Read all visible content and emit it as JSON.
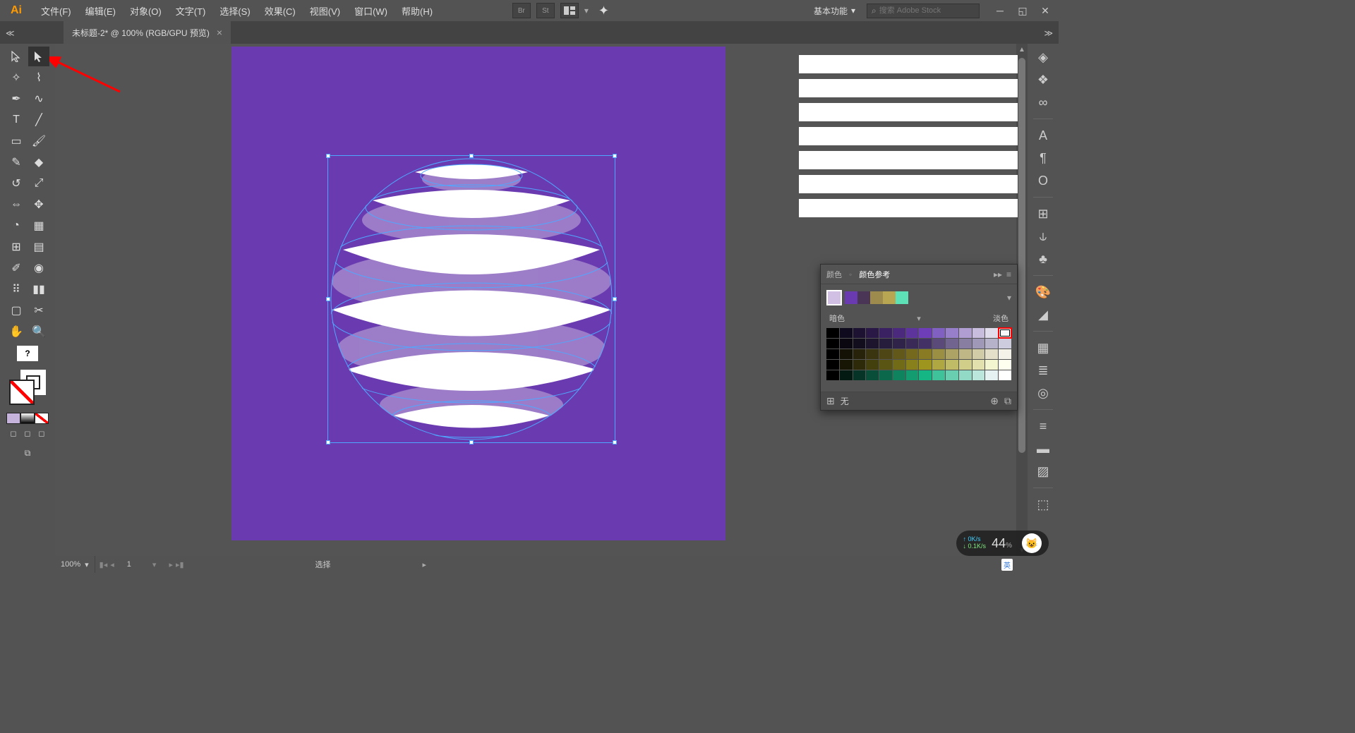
{
  "app": {
    "name": "Ai"
  },
  "menu": {
    "file": "文件(F)",
    "edit": "编辑(E)",
    "object": "对象(O)",
    "type": "文字(T)",
    "select": "选择(S)",
    "effect": "效果(C)",
    "view": "视图(V)",
    "window": "窗口(W)",
    "help": "帮助(H)"
  },
  "topbar": {
    "br": "Br",
    "st": "St",
    "workspace": "基本功能",
    "search_placeholder": "搜索 Adobe Stock"
  },
  "doc_tab": {
    "title": "未标题-2* @ 100% (RGB/GPU 预览)",
    "close": "×"
  },
  "zoom": {
    "value": "100%"
  },
  "artboard_nav": {
    "current": "1"
  },
  "status": {
    "tool": "选择"
  },
  "colorguide": {
    "tab1": "颜色",
    "tab2": "颜色参考",
    "dark_label": "暗色",
    "light_label": "淡色",
    "none_label": "无",
    "harmony_colors": [
      "#6a3bb0",
      "#4a3556",
      "#9d8a4d",
      "#b9a652",
      "#5de2b8"
    ],
    "main_swatch": "#d1bfe4",
    "grid": [
      [
        "#000000",
        "#100a1e",
        "#1e1232",
        "#2a1847",
        "#3a2162",
        "#4b2a7e",
        "#5c349b",
        "#6d3eb7",
        "#8060c0",
        "#987fc9",
        "#b09ed3",
        "#c8bddc",
        "#e0dceb",
        "#f8f8fb"
      ],
      [
        "#000000",
        "#0a0710",
        "#130e1e",
        "#1d152d",
        "#261c3b",
        "#302349",
        "#3a2a58",
        "#433166",
        "#5a4a7a",
        "#71648e",
        "#887ea2",
        "#9f98b6",
        "#b6b2ca",
        "#cdcbde"
      ],
      [
        "#000000",
        "#141205",
        "#27230a",
        "#3b350f",
        "#4e4614",
        "#625819",
        "#75691e",
        "#897b24",
        "#9b8f44",
        "#ada365",
        "#bfb786",
        "#d1cba7",
        "#e3dfc8",
        "#f5f3e9"
      ],
      [
        "#000000",
        "#171504",
        "#2d2a09",
        "#44400d",
        "#5a5512",
        "#716a16",
        "#87801b",
        "#9e951f",
        "#afa842",
        "#c0bb66",
        "#d1ce89",
        "#e2e1ad",
        "#f3f4d0",
        "#ffffef"
      ],
      [
        "#000000",
        "#031a13",
        "#063426",
        "#094e38",
        "#0c684b",
        "#0f825e",
        "#129c70",
        "#15b683",
        "#3fc299",
        "#68ceaf",
        "#92dac5",
        "#bbe6db",
        "#e5f2f1",
        "#ffffff"
      ]
    ],
    "highlight_row": 0,
    "highlight_col": 13
  },
  "net": {
    "up": "0K/s",
    "down": "0.1K/s",
    "pct": "44",
    "pct_suffix": "%"
  },
  "ime": {
    "lang": "英"
  }
}
